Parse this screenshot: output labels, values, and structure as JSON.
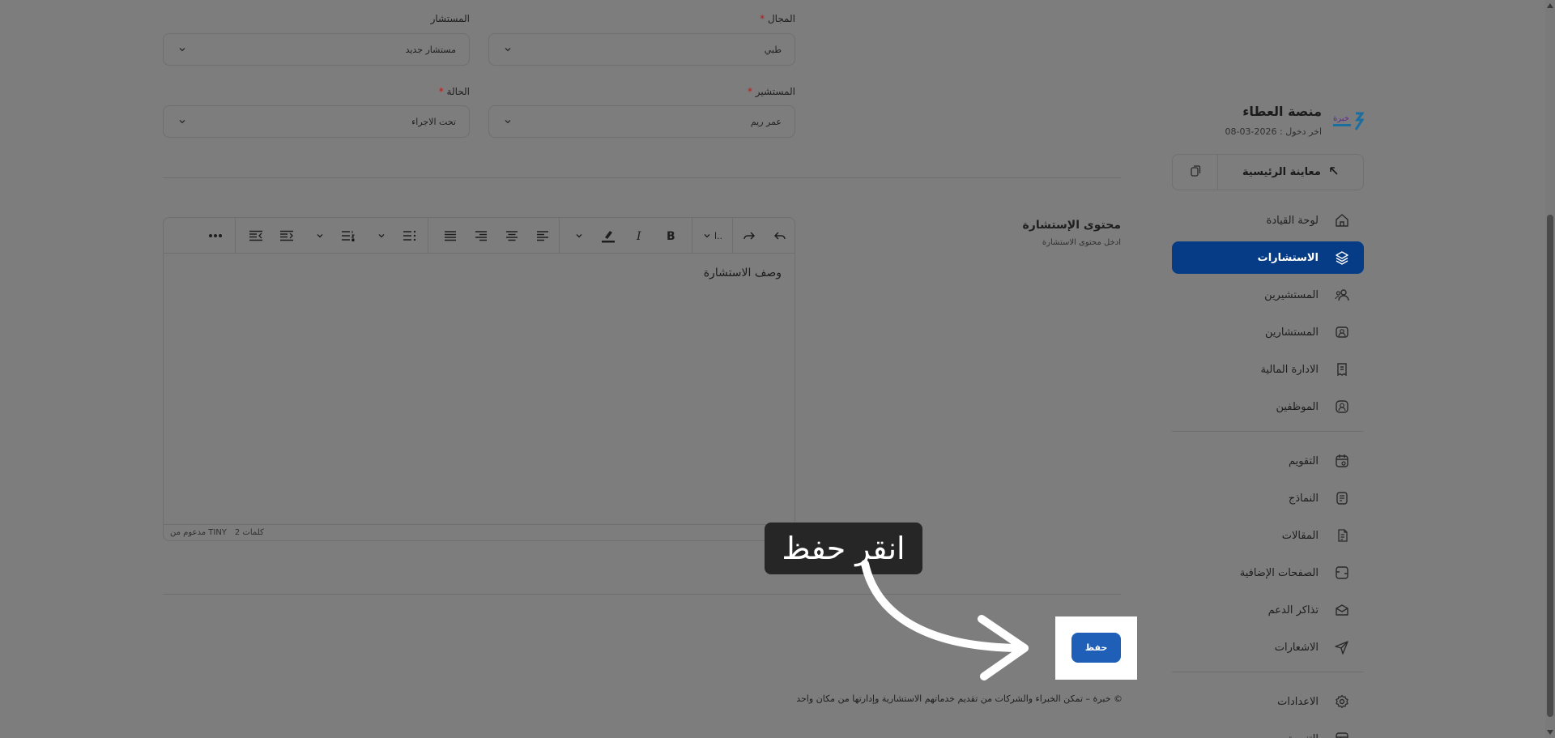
{
  "brand": {
    "title": "منصة العطاء",
    "logo_text": "خبرة",
    "last_login": "اخر دخول : 2026-03-08"
  },
  "sidebar": {
    "preview_label": "معاينة الرئيسية",
    "groups": [
      [
        {
          "label": "لوحة القيادة",
          "icon": "home-icon",
          "active": false
        },
        {
          "label": "الاستشارات",
          "icon": "layers-icon",
          "active": true
        },
        {
          "label": "المستشيرين",
          "icon": "users-icon",
          "active": false
        },
        {
          "label": "المستشارين",
          "icon": "consultant-icon",
          "active": false
        },
        {
          "label": "الادارة المالية",
          "icon": "invoice-icon",
          "active": false
        },
        {
          "label": "الموظفين",
          "icon": "user-badge-icon",
          "active": false
        }
      ],
      [
        {
          "label": "التقويم",
          "icon": "calendar-icon",
          "active": false
        },
        {
          "label": "النماذج",
          "icon": "form-icon",
          "active": false
        },
        {
          "label": "المقالات",
          "icon": "article-icon",
          "active": false
        },
        {
          "label": "الصفحات الإضافية",
          "icon": "pages-icon",
          "active": false
        },
        {
          "label": "تذاكر الدعم",
          "icon": "ticket-icon",
          "active": false
        },
        {
          "label": "الاشعارات",
          "icon": "send-icon",
          "active": false
        }
      ],
      [
        {
          "label": "الاعدادات",
          "icon": "gear-icon",
          "active": false
        },
        {
          "label": "التنسيق",
          "icon": "layout-icon",
          "active": false
        }
      ]
    ]
  },
  "form": {
    "field_label": "المجال",
    "field_value": "طبي",
    "consultant_label": "المستشار",
    "consultant_value": "مستشار جديد",
    "client_label": "المستشير",
    "client_value": "عمر ريم",
    "status_label": "الحالة",
    "status_value": "تحت الاجراء",
    "required_mark": "*"
  },
  "editor": {
    "section_title": "محتوى الإستشارة",
    "section_subtitle": "ادخل محتوى الاستشارة",
    "font_label": "ا..",
    "body_text": "وصف الاستشارة",
    "word_count": "2 كلمات",
    "powered_by": "مدعوم من TINY"
  },
  "actions": {
    "save_label": "حفظ"
  },
  "footer": {
    "text": "© خبرة – تمكن الخبراء والشركات من تقديم خدماتهم الاستشارية وإدارتها من مكان واحد"
  },
  "tutorial": {
    "tip_text": "انقر حفظ"
  },
  "colors": {
    "overlay": "#7d7d7d",
    "primary": "#063b86",
    "save_button": "#1f5fb8",
    "tip_bg": "#262626"
  }
}
